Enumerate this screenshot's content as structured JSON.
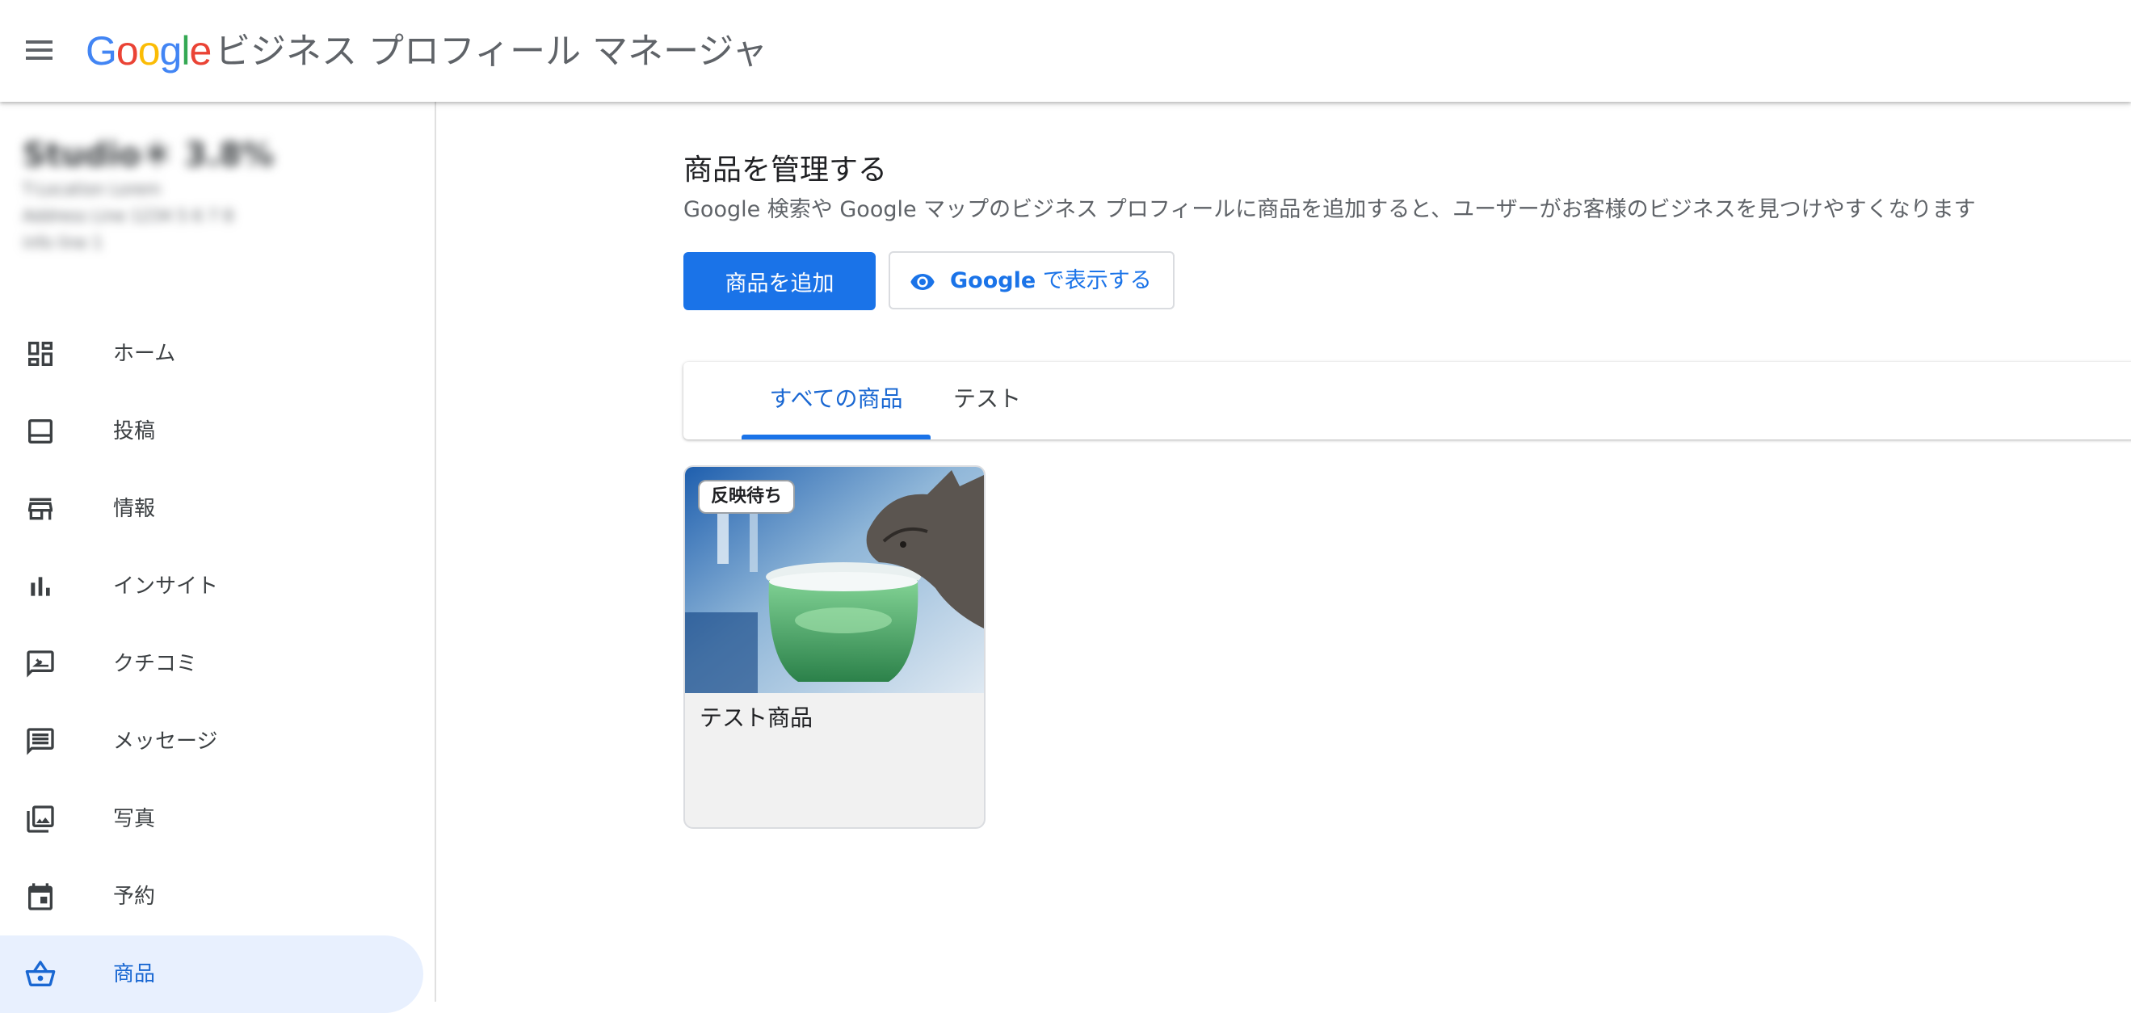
{
  "header": {
    "logo_text": "Google",
    "product_name": "ビジネス プロフィール マネージャ"
  },
  "business": {
    "name": "Studio＊ 3.8%",
    "lines": [
      "T-Location Lorem",
      "Address Line 1234 5 6 7 8",
      "info line 1"
    ]
  },
  "sidebar": {
    "items": [
      {
        "label": "ホーム",
        "icon": "dashboard-icon"
      },
      {
        "label": "投稿",
        "icon": "posts-icon"
      },
      {
        "label": "情報",
        "icon": "store-icon"
      },
      {
        "label": "インサイト",
        "icon": "bar-chart-icon"
      },
      {
        "label": "クチコミ",
        "icon": "rate-review-icon"
      },
      {
        "label": "メッセージ",
        "icon": "message-icon"
      },
      {
        "label": "写真",
        "icon": "photo-library-icon"
      },
      {
        "label": "予約",
        "icon": "calendar-icon"
      },
      {
        "label": "商品",
        "icon": "basket-icon"
      }
    ],
    "active_index": 8
  },
  "main": {
    "title": "商品を管理する",
    "subtitle": "Google 検索や Google マップのビジネス プロフィールに商品を追加すると、ユーザーがお客様のビジネスを見つけやすくなります",
    "add_button": "商品を追加",
    "view_button_brand": "Google",
    "view_button_rest": " で表示する",
    "tabs": [
      {
        "label": "すべての商品",
        "active": true
      },
      {
        "label": "テスト",
        "active": false
      }
    ],
    "products": [
      {
        "name": "テスト商品",
        "status": "反映待ち"
      }
    ]
  },
  "colors": {
    "accent": "#1a73e8",
    "active_nav_bg": "#e8f0fe",
    "active_text": "#1967d2"
  }
}
